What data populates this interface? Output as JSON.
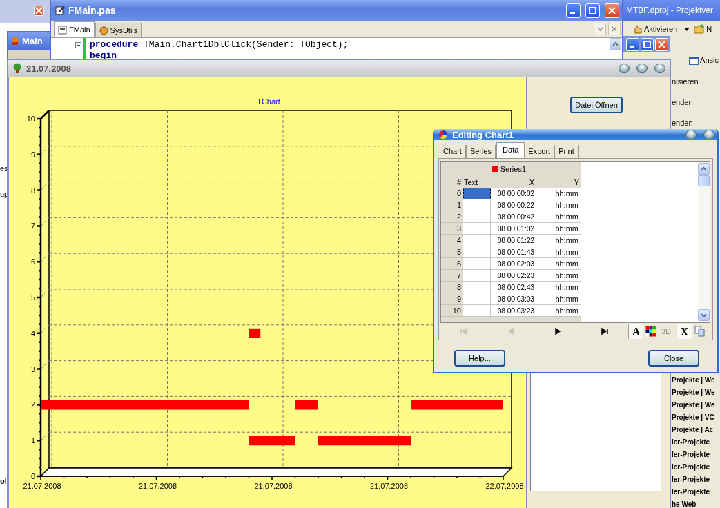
{
  "left_window": {
    "fragments": [
      "es",
      "up",
      "ol"
    ]
  },
  "main_window": {
    "title": "Main"
  },
  "editor_window": {
    "title": "FMain.pas",
    "tabs": [
      {
        "label": "FMain",
        "selected": true
      },
      {
        "label": "SysUtils",
        "selected": false
      }
    ],
    "code_lines": [
      "**procedure** TMain.Chart1DblClick(Sender: TObject);",
      "**begin**"
    ]
  },
  "project_window": {
    "title": "MTBF.dproj - Projektver",
    "toolbar": [
      "Aktivieren",
      "N"
    ],
    "toolbar_2": [
      "Ansic"
    ],
    "items": [
      "nisieren",
      "enden",
      "enden"
    ],
    "list": [
      "Projekte | We",
      "Projekte | We",
      "Projekte | We",
      "Projekte | VC",
      "Projekte | Ac",
      "ler-Projekte",
      "ler-Projekte",
      "ler-Projekte",
      "ler-Projekte",
      "ler-Projekte",
      "he Web"
    ]
  },
  "chart_window": {
    "title": "21.07.2008",
    "open_button": "Datei Öffnen",
    "chart_data": {
      "type": "line",
      "title": "TChart",
      "grid": true,
      "ylim": [
        0,
        10
      ],
      "yticks": [
        0,
        1,
        2,
        3,
        4,
        5,
        6,
        7,
        8,
        9,
        10
      ],
      "categories": [
        "21.07.2008",
        null,
        null,
        null,
        null,
        null,
        null,
        null,
        null,
        null,
        "21.07.2008",
        null,
        null,
        null,
        null,
        null,
        null,
        null,
        null,
        null,
        "21.07.2008",
        null,
        null,
        null,
        null,
        null,
        null,
        null,
        null,
        null,
        "21.07.2008",
        null,
        null,
        null,
        null,
        null,
        null,
        null,
        null,
        null,
        "22.07.2008"
      ],
      "series": [
        {
          "color": "#ff0000",
          "values": [
            2,
            2,
            2,
            2,
            2,
            2,
            2,
            2,
            2,
            2,
            2,
            2,
            2,
            2,
            2,
            2,
            2,
            2,
            2,
            null,
            null,
            null,
            2,
            2,
            2,
            null,
            null,
            null,
            null,
            null,
            null,
            null,
            2,
            2,
            2,
            2,
            2,
            2,
            2,
            2,
            2
          ]
        },
        {
          "color": "#ff0000",
          "values": [
            null,
            null,
            null,
            null,
            null,
            null,
            null,
            null,
            null,
            null,
            null,
            null,
            null,
            null,
            null,
            null,
            null,
            null,
            4,
            4,
            null,
            null,
            null,
            null,
            null,
            null,
            null,
            null,
            null,
            null,
            null,
            null,
            null,
            null,
            null,
            null,
            null,
            null,
            null,
            null,
            null
          ]
        },
        {
          "color": "#ff0000",
          "values": [
            null,
            null,
            null,
            null,
            null,
            null,
            null,
            null,
            null,
            null,
            null,
            null,
            null,
            null,
            null,
            null,
            null,
            null,
            1,
            1,
            1,
            1,
            1,
            null,
            1,
            1,
            1,
            1,
            1,
            1,
            1,
            1,
            1,
            null,
            null,
            null,
            null,
            null,
            null,
            null,
            null
          ]
        }
      ]
    }
  },
  "editor_dialog": {
    "title": "Editing Chart1",
    "tabs": [
      {
        "label": "Chart",
        "selected": false
      },
      {
        "label": "Series",
        "selected": false
      },
      {
        "label": "Data",
        "selected": true
      },
      {
        "label": "Export",
        "selected": false
      },
      {
        "label": "Print",
        "selected": false
      }
    ],
    "series": {
      "name": "Series1",
      "color": "#ff0000"
    },
    "columns": [
      "#",
      "Text",
      "X",
      "Y"
    ],
    "rows": [
      {
        "index": "0",
        "selected": true,
        "x": "08 00:00:02",
        "y": "hh:mm"
      },
      {
        "index": "1",
        "selected": false,
        "x": "08 00:00:22",
        "y": "hh:mm"
      },
      {
        "index": "2",
        "selected": false,
        "x": "08 00:00:42",
        "y": "hh:mm"
      },
      {
        "index": "3",
        "selected": false,
        "x": "08 00:01:02",
        "y": "hh:mm"
      },
      {
        "index": "4",
        "selected": false,
        "x": "08 00:01:22",
        "y": "hh:mm"
      },
      {
        "index": "5",
        "selected": false,
        "x": "08 00:01:43",
        "y": "hh:mm"
      },
      {
        "index": "6",
        "selected": false,
        "x": "08 00:02:03",
        "y": "hh:mm"
      },
      {
        "index": "7",
        "selected": false,
        "x": "08 00:02:23",
        "y": "hh:mm"
      },
      {
        "index": "8",
        "selected": false,
        "x": "08 00:02:43",
        "y": "hh:mm"
      },
      {
        "index": "9",
        "selected": false,
        "x": "08 00:03:03",
        "y": "hh:mm"
      },
      {
        "index": "10",
        "selected": false,
        "x": "08 00:03:23",
        "y": "hh:mm"
      }
    ],
    "nav_buttons": [
      {
        "kind": "first",
        "disabled": true
      },
      {
        "kind": "prev",
        "disabled": true
      },
      {
        "kind": "next",
        "disabled": false
      },
      {
        "kind": "last",
        "disabled": false
      }
    ],
    "tool_buttons": [
      {
        "kind": "font",
        "label": "A",
        "disabled": false
      },
      {
        "kind": "palette",
        "disabled": false
      },
      {
        "kind": "depth",
        "label": "3D",
        "disabled": true
      },
      {
        "kind": "delete",
        "label": "X",
        "disabled": false
      },
      {
        "kind": "copy",
        "disabled": false
      }
    ],
    "buttons": [
      "Help...",
      "Close"
    ]
  }
}
